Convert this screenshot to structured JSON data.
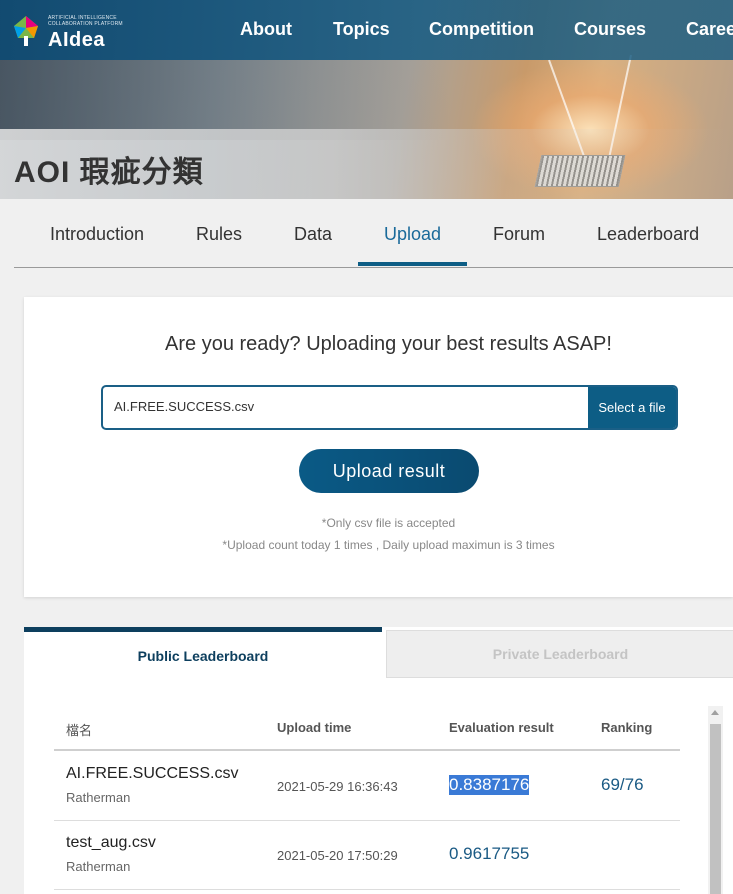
{
  "header": {
    "logo_tagline": "ARTIFICIAL INTELLIGENCE COLLABORATION PLATFORM",
    "logo_name": "AIdea",
    "nav": [
      "About",
      "Topics",
      "Competition",
      "Courses",
      "Caree"
    ]
  },
  "page_title": "AOI 瑕疵分類",
  "tabs": [
    "Introduction",
    "Rules",
    "Data",
    "Upload",
    "Forum",
    "Leaderboard"
  ],
  "active_tab": "Upload",
  "upload": {
    "heading": "Are you ready? Uploading your best results ASAP!",
    "file_name": "AI.FREE.SUCCESS.csv",
    "select_label": "Select a file",
    "upload_button": "Upload result",
    "note_csv": "*Only csv file is accepted",
    "note_count": "*Upload count today 1 times , Daily upload maximun is 3 times"
  },
  "leaderboard": {
    "public_tab": "Public Leaderboard",
    "private_tab": "Private Leaderboard",
    "columns": [
      "檔名",
      "Upload time",
      "Evaluation result",
      "Ranking"
    ],
    "rows": [
      {
        "file": "AI.FREE.SUCCESS.csv",
        "user": "Ratherman",
        "time": "2021-05-29 16:36:43",
        "score": "0.8387176",
        "rank": "69/76"
      },
      {
        "file": "test_aug.csv",
        "user": "Ratherman",
        "time": "2021-05-20 17:50:29",
        "score": "0.9617755",
        "rank": ""
      }
    ]
  },
  "colors": {
    "primary": "#0d5d85",
    "active_tab": "#1a6a9a",
    "score_text": "#1a5a84"
  }
}
